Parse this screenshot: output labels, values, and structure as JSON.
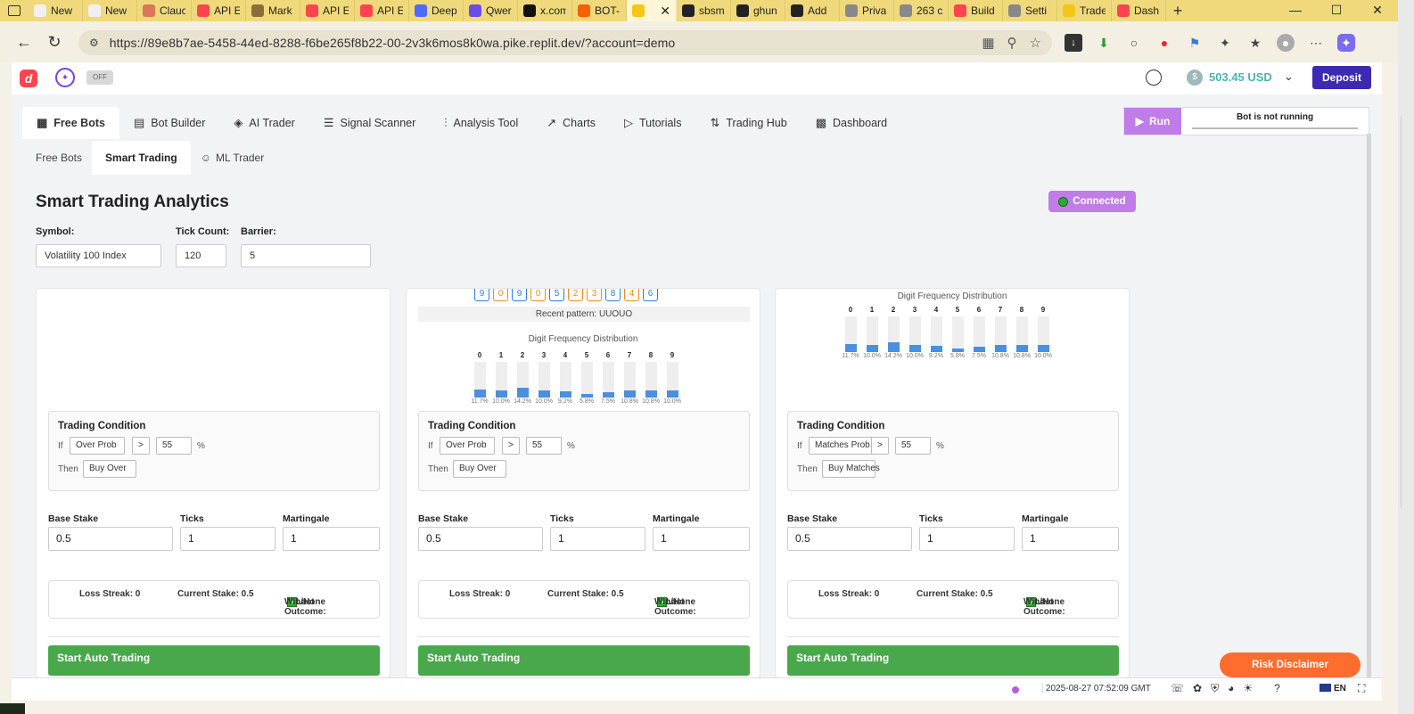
{
  "browser": {
    "tabs": [
      {
        "label": "New",
        "icon_color": "#f0f0f0"
      },
      {
        "label": "New",
        "icon_color": "#f0f0f0"
      },
      {
        "label": "Clauc",
        "icon_color": "#d97757"
      },
      {
        "label": "API E",
        "icon_color": "#ff444f"
      },
      {
        "label": "Mark",
        "icon_color": "#8a6d3b"
      },
      {
        "label": "API E",
        "icon_color": "#ff444f"
      },
      {
        "label": "API E",
        "icon_color": "#ff444f"
      },
      {
        "label": "Deep",
        "icon_color": "#4d6bfe"
      },
      {
        "label": "Qwer",
        "icon_color": "#6b4ce6"
      },
      {
        "label": "x.com",
        "icon_color": "#111111"
      },
      {
        "label": "BOT-",
        "icon_color": "#f26207"
      },
      {
        "label": "",
        "icon_color": "#f5c518"
      },
      {
        "label": "sbsm",
        "icon_color": "#222222"
      },
      {
        "label": "ghun",
        "icon_color": "#222222"
      },
      {
        "label": "Add",
        "icon_color": "#222222"
      },
      {
        "label": "Priva",
        "icon_color": "#888888"
      },
      {
        "label": "263 c",
        "icon_color": "#888888"
      },
      {
        "label": "Build",
        "icon_color": "#ff444f"
      },
      {
        "label": "Setti",
        "icon_color": "#888888"
      },
      {
        "label": "Trade",
        "icon_color": "#f5c518"
      },
      {
        "label": "Dash",
        "icon_color": "#ff444f"
      }
    ],
    "url": "https://89e8b7ae-5458-44ed-8288-f6be265f8b22-00-2v3k6mos8k0wa.pike.replit.dev/?account=demo"
  },
  "header": {
    "off_label": "OFF",
    "balance": "503.45 USD",
    "deposit_label": "Deposit"
  },
  "nav": {
    "tabs": [
      {
        "label": "Free Bots",
        "icon": "grid-icon"
      },
      {
        "label": "Bot Builder",
        "icon": "puzzle-icon"
      },
      {
        "label": "AI Trader",
        "icon": "layers-icon"
      },
      {
        "label": "Signal Scanner",
        "icon": "list-icon"
      },
      {
        "label": "Analysis Tool",
        "icon": "sliders-icon"
      },
      {
        "label": "Charts",
        "icon": "chart-icon"
      },
      {
        "label": "Tutorials",
        "icon": "play-icon"
      },
      {
        "label": "Trading Hub",
        "icon": "arrows-icon"
      },
      {
        "label": "Dashboard",
        "icon": "dashboard-icon"
      }
    ],
    "subtabs": [
      "Free Bots",
      "Smart Trading",
      "ML Trader"
    ]
  },
  "run_panel": {
    "run_label": "Run",
    "status": "Bot is not running"
  },
  "main": {
    "title": "Smart Trading Analytics",
    "connection": "Connected",
    "symbol_label": "Symbol:",
    "symbol_value": "Volatility 100 Index",
    "tick_count_label": "Tick Count:",
    "tick_count_value": "120",
    "barrier_label": "Barrier:",
    "barrier_value": "5"
  },
  "recent_digits": [
    {
      "d": "9",
      "c": "b"
    },
    {
      "d": "0",
      "c": "o"
    },
    {
      "d": "9",
      "c": "b"
    },
    {
      "d": "0",
      "c": "o"
    },
    {
      "d": "5",
      "c": "b"
    },
    {
      "d": "2",
      "c": "o"
    },
    {
      "d": "3",
      "c": "o"
    },
    {
      "d": "8",
      "c": "b"
    },
    {
      "d": "4",
      "c": "o"
    },
    {
      "d": "6",
      "c": "b"
    }
  ],
  "recent_pattern": "Recent pattern: UUOUO",
  "freq_title": "Digit Frequency Distribution",
  "freq": [
    {
      "digit": "0",
      "pct": "11.7%",
      "val": 11.7
    },
    {
      "digit": "1",
      "pct": "10.0%",
      "val": 10.0
    },
    {
      "digit": "2",
      "pct": "14.2%",
      "val": 14.2
    },
    {
      "digit": "3",
      "pct": "10.0%",
      "val": 10.0
    },
    {
      "digit": "4",
      "pct": "9.2%",
      "val": 9.2
    },
    {
      "digit": "5",
      "pct": "5.8%",
      "val": 5.8
    },
    {
      "digit": "6",
      "pct": "7.5%",
      "val": 7.5
    },
    {
      "digit": "7",
      "pct": "10.8%",
      "val": 10.8
    },
    {
      "digit": "8",
      "pct": "10.8%",
      "val": 10.8
    },
    {
      "digit": "9",
      "pct": "10.0%",
      "val": 10.0
    }
  ],
  "cards": [
    {
      "tc_title": "Trading Condition",
      "if_label": "If",
      "condition": "Over Prob",
      "op": ">",
      "threshold": "55",
      "pct": "%",
      "then_label": "Then",
      "action": "Buy Over",
      "base_label": "Base Stake",
      "base": "0.5",
      "ticks_label": "Ticks",
      "ticks": "1",
      "mart_label": "Martingale",
      "mart": "1",
      "loss": "Loss Streak: 0",
      "stake": "Current Stake: 0.5",
      "outcome": "Last Outcome:",
      "outcome2": "Win/None",
      "start": "Start Auto Trading"
    },
    {
      "tc_title": "Trading Condition",
      "if_label": "If",
      "condition": "Over Prob",
      "op": ">",
      "threshold": "55",
      "pct": "%",
      "then_label": "Then",
      "action": "Buy Over",
      "base_label": "Base Stake",
      "base": "0.5",
      "ticks_label": "Ticks",
      "ticks": "1",
      "mart_label": "Martingale",
      "mart": "1",
      "loss": "Loss Streak: 0",
      "stake": "Current Stake: 0.5",
      "outcome": "Last Outcome:",
      "outcome2": "Win/None",
      "start": "Start Auto Trading"
    },
    {
      "tc_title": "Trading Condition",
      "if_label": "If",
      "condition": "Matches Prob",
      "op": ">",
      "threshold": "55",
      "pct": "%",
      "then_label": "Then",
      "action": "Buy Matches",
      "base_label": "Base Stake",
      "base": "0.5",
      "ticks_label": "Ticks",
      "ticks": "1",
      "mart_label": "Martingale",
      "mart": "1",
      "loss": "Loss Streak: 0",
      "stake": "Current Stake: 0.5",
      "outcome": "Last Outcome:",
      "outcome2": "Win/None",
      "start": "Start Auto Trading"
    }
  ],
  "footer": {
    "time": "2025-08-27 07:52:09 GMT",
    "lang": "EN",
    "risk": "Risk Disclaimer"
  }
}
